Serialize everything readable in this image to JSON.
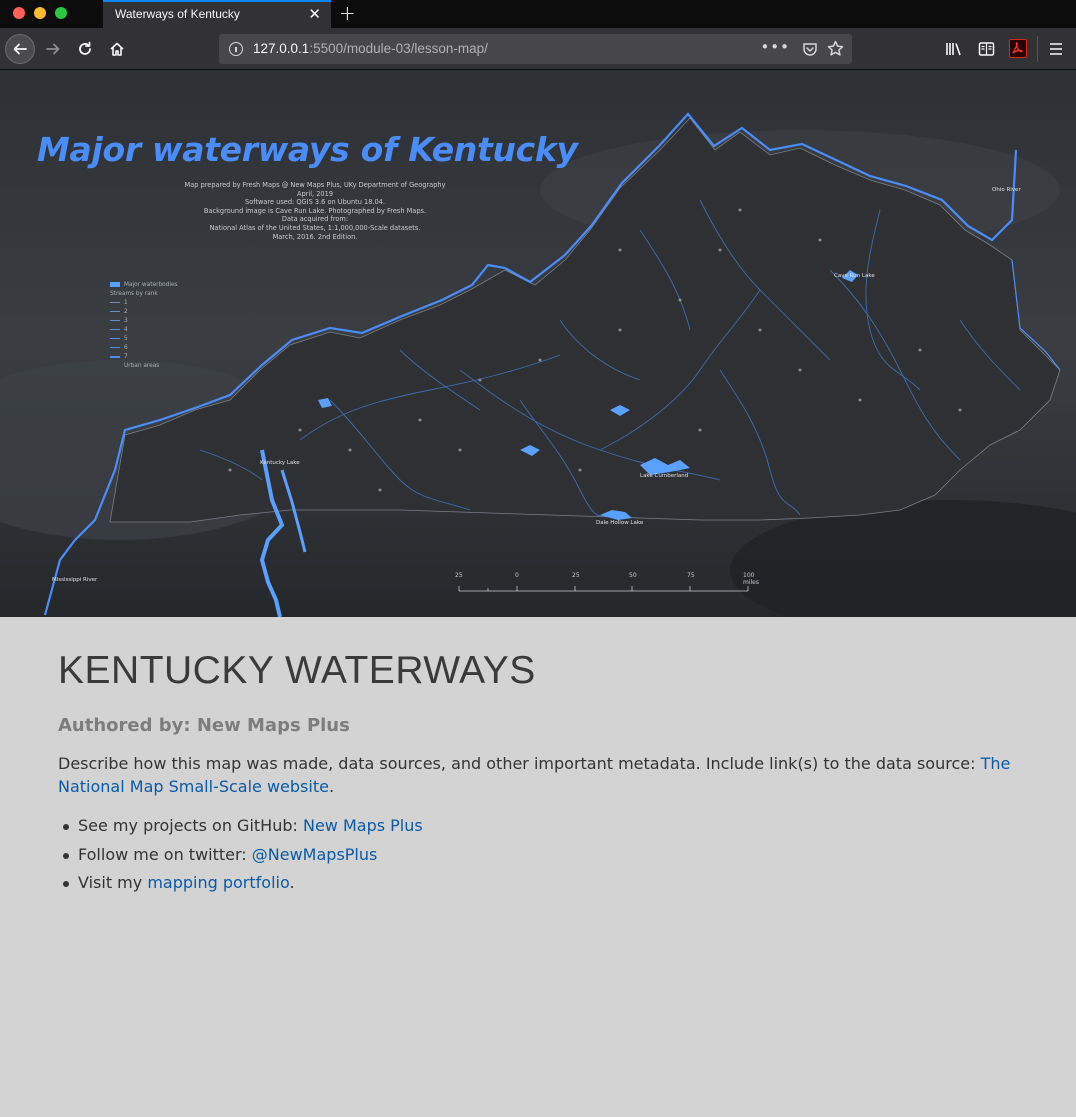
{
  "browser": {
    "tab_title": "Waterways of Kentucky",
    "url_host": "127.0.0.1",
    "url_path": ":5500/module-03/lesson-map/"
  },
  "map": {
    "title": "Major waterways of Kentucky",
    "metadata": [
      "Map prepared by Fresh Maps @ New Maps Plus, UKy Department of Geography",
      "April, 2019",
      "Software used: QGIS 3.6 on Ubuntu 18.04.",
      "Background image is Cave Run Lake. Photographed by Fresh Maps.",
      "Data acquired from:",
      "National Atlas of the United States, 1:1,000,000-Scale datasets.",
      "March, 2016. 2nd Edition."
    ],
    "legend": {
      "waterbodies": "Major waterbodies",
      "streams_heading": "Streams by rank",
      "ranks": [
        "1",
        "2",
        "3",
        "4",
        "5",
        "6",
        "7"
      ],
      "urban": "Urban areas"
    },
    "scale_labels": [
      "25",
      "0",
      "25",
      "50",
      "75",
      "100 miles"
    ],
    "place_labels": {
      "ohio_river": "Ohio River",
      "mississippi_river": "Mississippi River",
      "cave_run_lake": "Cave Run Lake",
      "lake_cumberland": "Lake Cumberland",
      "dale_hollow_lake": "Dale Hollow Lake",
      "kentucky_lake": "Kentucky Lake"
    },
    "colors": {
      "water": "#4b8df8",
      "land": "#2e3033",
      "title": "#4b8df8"
    }
  },
  "page": {
    "title": "KENTUCKY WATERWAYS",
    "author": "Authored by: New Maps Plus",
    "description": "Describe how this map was made, data sources, and other important metadata. Include link(s) to the data source: ",
    "description_link": "The National Map Small-Scale website",
    "description_end": ".",
    "bullets": [
      {
        "prefix": "See my projects on GitHub: ",
        "link": "New Maps Plus",
        "suffix": ""
      },
      {
        "prefix": "Follow me on twitter: ",
        "link": "@NewMapsPlus",
        "suffix": ""
      },
      {
        "prefix": "Visit my ",
        "link": "mapping portfolio",
        "suffix": "."
      }
    ]
  }
}
